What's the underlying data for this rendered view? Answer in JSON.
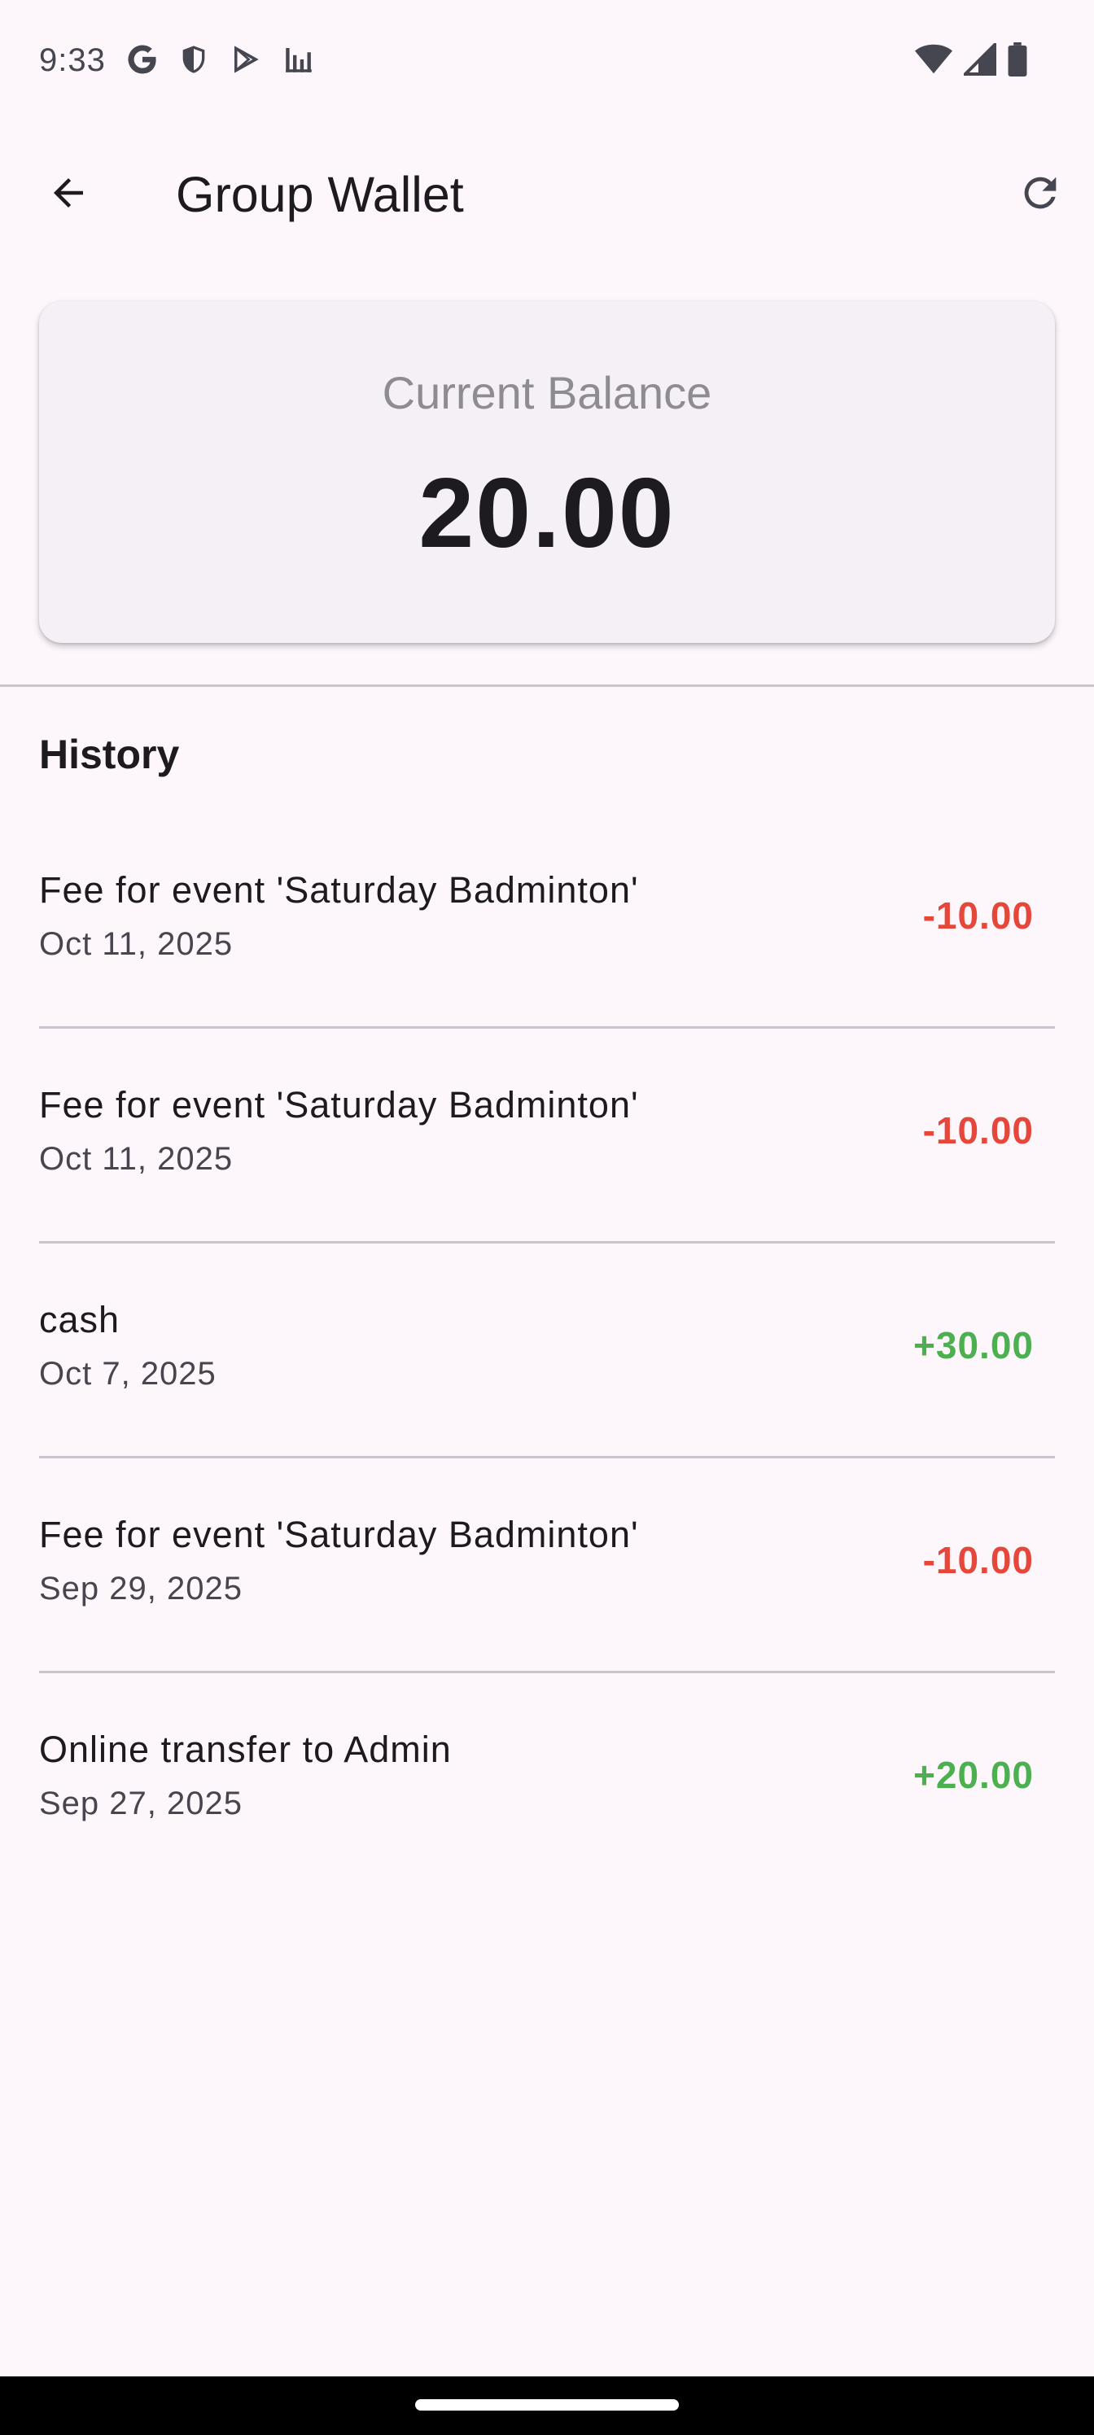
{
  "status_bar": {
    "time": "9:33",
    "left_icons": [
      "google-icon",
      "shield-icon",
      "play-store-icon",
      "bar-chart-icon"
    ],
    "right_icons": [
      "wifi-icon",
      "cellular-signal-icon",
      "battery-icon"
    ]
  },
  "app_bar": {
    "title": "Group Wallet",
    "back_icon": "arrow-back-icon",
    "refresh_icon": "refresh-icon"
  },
  "balance": {
    "label": "Current Balance",
    "value": "20.00"
  },
  "history": {
    "title": "History",
    "transactions": [
      {
        "description": "Fee for event 'Saturday Badminton'",
        "date": "Oct 11, 2025",
        "amount": "-10.00",
        "type": "debit"
      },
      {
        "description": "Fee for event 'Saturday Badminton'",
        "date": "Oct 11, 2025",
        "amount": "-10.00",
        "type": "debit"
      },
      {
        "description": "cash",
        "date": "Oct 7, 2025",
        "amount": "+30.00",
        "type": "credit"
      },
      {
        "description": "Fee for event 'Saturday Badminton'",
        "date": "Sep 29, 2025",
        "amount": "-10.00",
        "type": "debit"
      },
      {
        "description": "Online transfer to Admin",
        "date": "Sep 27, 2025",
        "amount": "+20.00",
        "type": "credit"
      }
    ]
  },
  "colors": {
    "debit": "#e5473a",
    "credit": "#4caf50",
    "background": "#fdf7fc",
    "card": "#f5f0f6"
  }
}
